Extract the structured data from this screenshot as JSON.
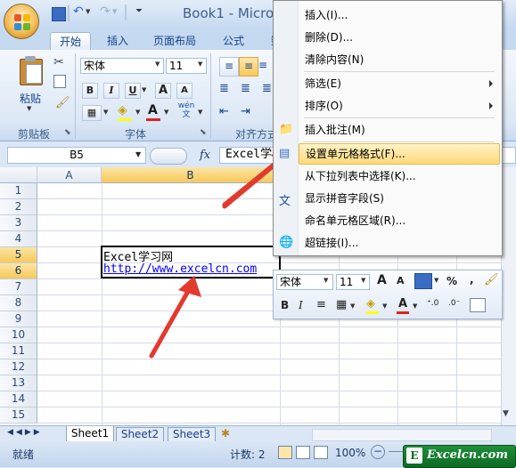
{
  "window": {
    "title": "Book1 - Micro"
  },
  "ribbon": {
    "tabs": [
      {
        "label": "开始",
        "active": true
      },
      {
        "label": "插入",
        "active": false
      },
      {
        "label": "页面布局",
        "active": false
      },
      {
        "label": "公式",
        "active": false
      }
    ],
    "clipboard": {
      "paste_label": "粘贴",
      "group_label": "剪贴板"
    },
    "font": {
      "name": "宋体",
      "size": "11",
      "group_label": "字体",
      "bold": "B",
      "italic": "I",
      "underline": "U",
      "grow": "A",
      "shrink": "A"
    },
    "alignment": {
      "group_label": "对齐方式"
    }
  },
  "formula_bar": {
    "name_box": "B5",
    "fx": "fx",
    "content": "Excel学"
  },
  "sheet": {
    "columns": [
      "A",
      "B"
    ],
    "rows": [
      "1",
      "2",
      "3",
      "4",
      "5",
      "6",
      "7",
      "8",
      "9",
      "10",
      "11",
      "12",
      "13",
      "14",
      "15"
    ],
    "selected_row_labels": [
      "5",
      "6"
    ],
    "cells": {
      "B5": "Excel学习网",
      "B6": "http://www.excelcn.com"
    }
  },
  "sheet_tabs": [
    "Sheet1",
    "Sheet2",
    "Sheet3"
  ],
  "status": {
    "mode": "就绪",
    "count": "计数: 2",
    "zoom": "100%"
  },
  "context_menu": {
    "items": [
      {
        "label": "插入(I)...",
        "icon": "",
        "submenu": false,
        "highlighted": false
      },
      {
        "label": "删除(D)...",
        "icon": "",
        "submenu": false,
        "highlighted": false
      },
      {
        "label": "清除内容(N)",
        "icon": "",
        "submenu": false,
        "highlighted": false
      },
      {
        "label": "筛选(E)",
        "icon": "",
        "submenu": true,
        "highlighted": false
      },
      {
        "label": "排序(O)",
        "icon": "",
        "submenu": true,
        "highlighted": false
      },
      {
        "label": "插入批注(M)",
        "icon": "comment-icon",
        "submenu": false,
        "highlighted": false
      },
      {
        "label": "设置单元格格式(F)...",
        "icon": "format-cells-icon",
        "submenu": false,
        "highlighted": true
      },
      {
        "label": "从下拉列表中选择(K)...",
        "icon": "",
        "submenu": false,
        "highlighted": false
      },
      {
        "label": "显示拼音字段(S)",
        "icon": "phonetic-icon",
        "submenu": false,
        "highlighted": false
      },
      {
        "label": "命名单元格区域(R)...",
        "icon": "",
        "submenu": false,
        "highlighted": false
      },
      {
        "label": "超链接(I)...",
        "icon": "hyperlink-icon",
        "submenu": false,
        "highlighted": false
      }
    ]
  },
  "mini_toolbar": {
    "font": "宋体",
    "size": "11",
    "percent": "%",
    "comma": ","
  },
  "watermark": {
    "text": "Excelcn.com",
    "letter": "E"
  },
  "colors": {
    "accent": "#f7c85b",
    "arrow": "#e23a2e",
    "link": "#0000ff"
  }
}
